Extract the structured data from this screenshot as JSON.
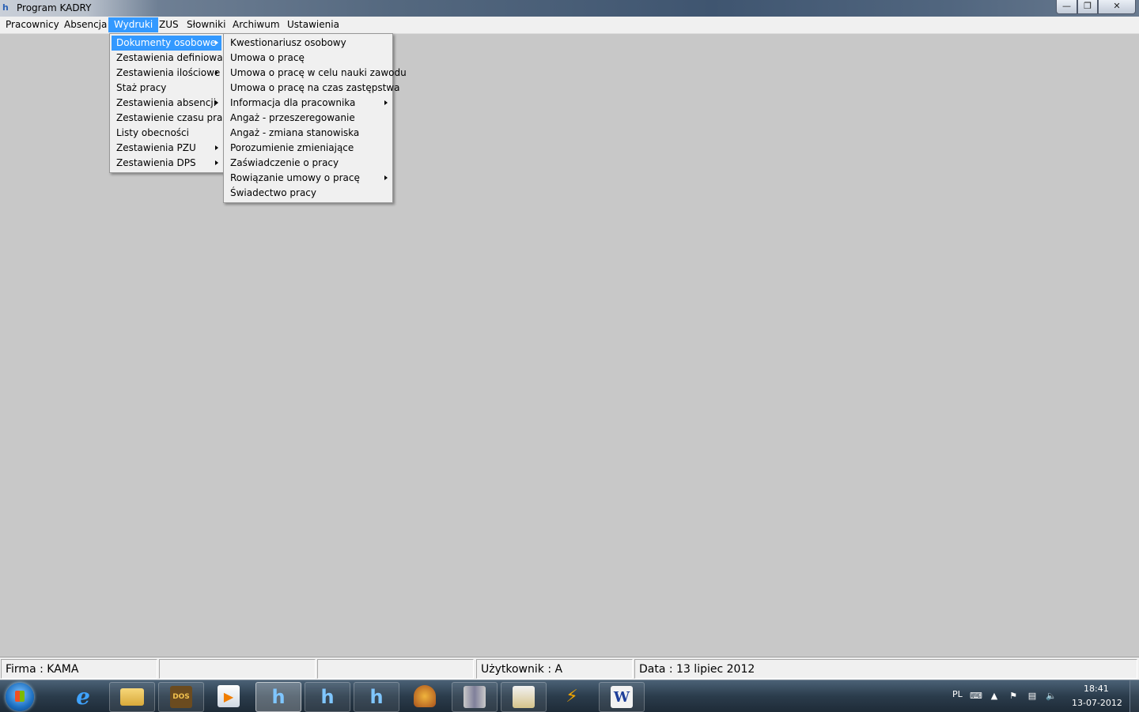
{
  "window": {
    "title": "Program KADRY"
  },
  "menubar": {
    "items": [
      {
        "label": "Pracownicy"
      },
      {
        "label": "Absencja"
      },
      {
        "label": "Wydruki"
      },
      {
        "label": "ZUS"
      },
      {
        "label": "Słowniki"
      },
      {
        "label": "Archiwum"
      },
      {
        "label": "Ustawienia"
      }
    ]
  },
  "wydruki_menu": {
    "items": [
      {
        "label": "Dokumenty osobowe"
      },
      {
        "label": "Zestawienia definiowane"
      },
      {
        "label": "Zestawienia ilościowe"
      },
      {
        "label": "Staż pracy"
      },
      {
        "label": "Zestawienia absencji"
      },
      {
        "label": "Zestawienie czasu pracy"
      },
      {
        "label": "Listy obecności"
      },
      {
        "label": "Zestawienia PZU"
      },
      {
        "label": "Zestawienia DPS"
      }
    ]
  },
  "dokumenty_menu": {
    "items": [
      {
        "label": "Kwestionariusz osobowy"
      },
      {
        "label": "Umowa o pracę"
      },
      {
        "label": "Umowa o pracę w celu nauki zawodu"
      },
      {
        "label": "Umowa o pracę na czas zastępstwa"
      },
      {
        "label": "Informacja dla pracownika"
      },
      {
        "label": "Angaż - przeszeregowanie"
      },
      {
        "label": "Angaż - zmiana stanowiska"
      },
      {
        "label": "Porozumienie zmieniające"
      },
      {
        "label": "Zaświadczenie o pracy"
      },
      {
        "label": "Rowiązanie umowy o pracę"
      },
      {
        "label": "Świadectwo pracy"
      }
    ]
  },
  "statusbar": {
    "firma": "Firma : KAMA",
    "empty1": "",
    "empty2": "",
    "uzytkownik": "Użytkownik : A",
    "data": "Data : 13 lipiec 2012"
  },
  "taskbar": {
    "language": "PL",
    "time": "18:41",
    "date": "13-07-2012",
    "apps": [
      {
        "icon": "internet-explorer-icon"
      },
      {
        "icon": "file-explorer-icon"
      },
      {
        "icon": "dosbox-icon",
        "text": "DOS"
      },
      {
        "icon": "media-player-icon"
      },
      {
        "icon": "kadry-app-icon",
        "text": "h"
      },
      {
        "icon": "kadry-app-icon",
        "text": "h"
      },
      {
        "icon": "kadry-app-icon",
        "text": "h"
      },
      {
        "icon": "helmet-icon"
      },
      {
        "icon": "archive-icon"
      },
      {
        "icon": "folder-app-icon"
      },
      {
        "icon": "lightning-icon"
      },
      {
        "icon": "word-icon",
        "text": "W"
      }
    ]
  },
  "colors": {
    "highlight": "#3399ff",
    "desktop_bg": "#c8c8c8",
    "menu_bg": "#f0f0f0"
  }
}
